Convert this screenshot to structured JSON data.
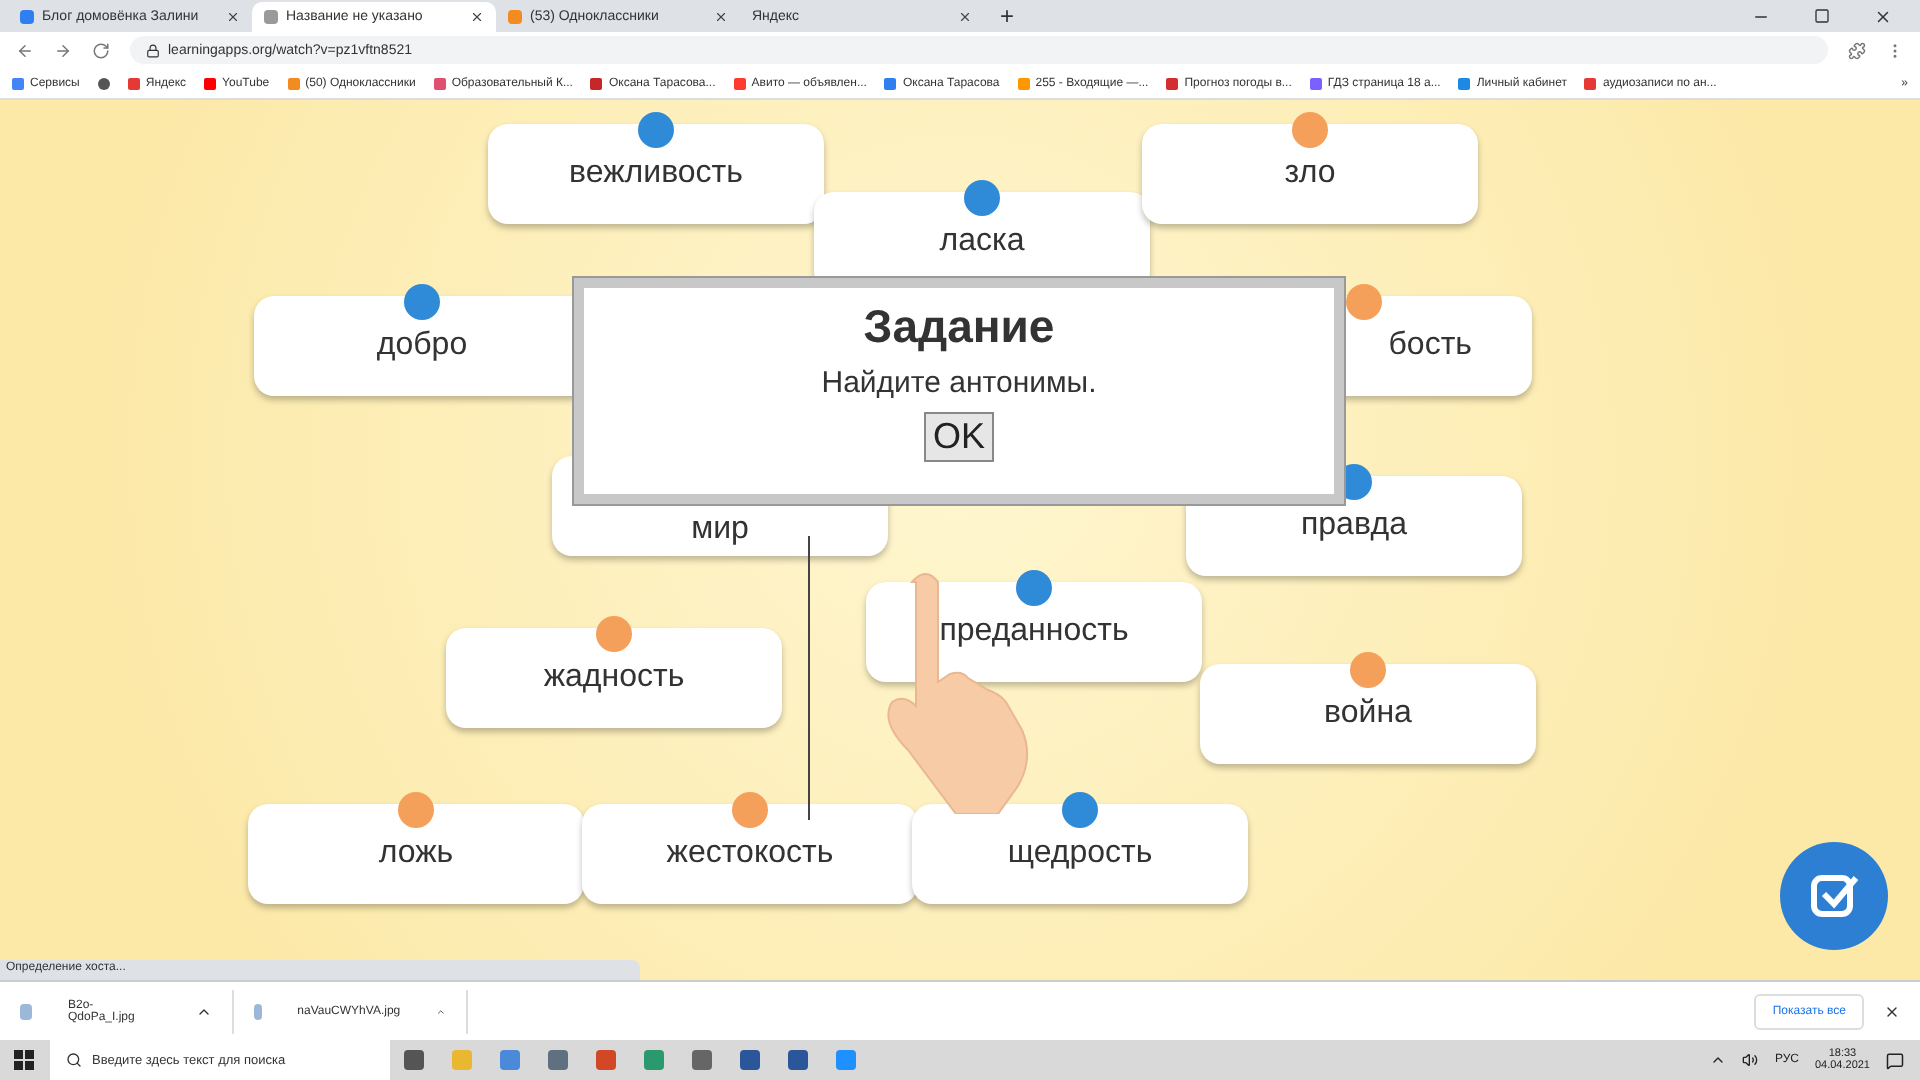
{
  "browser": {
    "tabs": [
      {
        "title": "Блог домовёнка Залини",
        "selected": false,
        "color": "#2f7ff0"
      },
      {
        "title": "Название не указано",
        "selected": true,
        "color": "#9a9a9a"
      },
      {
        "title": "(53) Одноклассники",
        "selected": false,
        "color": "#f28b20"
      },
      {
        "title": "Яндекс",
        "selected": false
      }
    ],
    "new_tab": "+",
    "url": "learningapps.org/watch?v=pz1vftn8521",
    "bookmarks": [
      {
        "label": "Сервисы",
        "color": "#4285f4"
      },
      {
        "color": "#555555"
      },
      {
        "label": "Яндекс",
        "color": "#e53935"
      },
      {
        "label": "YouTube",
        "color": "#ff0000"
      },
      {
        "label": "(50) Одноклассники",
        "color": "#f28b20"
      },
      {
        "label": "Образовательный К...",
        "color": "#e05070"
      },
      {
        "label": "Оксана Тарасова...",
        "color": "#c62828"
      },
      {
        "label": "Авито — объявлен...",
        "color": "#ff3b30"
      },
      {
        "label": "Оксана Тарасова",
        "color": "#2f7ff0"
      },
      {
        "label": "255 - Входящие —...",
        "color": "#ff9800"
      },
      {
        "label": "Прогноз погоды в...",
        "color": "#d32f2f"
      },
      {
        "label": "ГДЗ страница 18 а...",
        "color": "#7b61ff"
      },
      {
        "label": "Личный кабинет",
        "color": "#1e88e5"
      },
      {
        "label": "аудиозаписи по ан...",
        "color": "#e53935"
      }
    ],
    "more": "»"
  },
  "app": {
    "cards": [
      {
        "text": "вежливость",
        "color": "#2f8ad8"
      },
      {
        "text": "ласка",
        "color": "#2f8ad8"
      },
      {
        "text": "зло",
        "color": "#f5a05a"
      },
      {
        "text": "добро",
        "color": "#2f8ad8"
      },
      {
        "text": "бость",
        "color": "#f5a05a"
      },
      {
        "text": "мир"
      },
      {
        "text": "правда",
        "color": "#2f8ad8"
      },
      {
        "text": "преданность",
        "color": "#2f8ad8"
      },
      {
        "text": "жадность",
        "color": "#f5a05a"
      },
      {
        "text": "война",
        "color": "#f5a05a"
      },
      {
        "text": "ложь",
        "color": "#f5a05a"
      },
      {
        "text": "жестокость",
        "color": "#f5a05a"
      },
      {
        "text": "щедрость",
        "color": "#2f8ad8"
      }
    ],
    "dialog": {
      "title": "Задание",
      "message": "Найдите антонимы.",
      "button": "OK"
    }
  },
  "status": "Определение хоста...",
  "downloads": {
    "files": [
      "B2o-QdoPa_I.jpg",
      "naVauCWYhVA.jpg"
    ],
    "show_all": "Показать все"
  },
  "taskbar": {
    "search_placeholder": "Введите здесь текст для поиска",
    "language": "РУС",
    "time": "18:33",
    "date": "04.04.2021"
  }
}
